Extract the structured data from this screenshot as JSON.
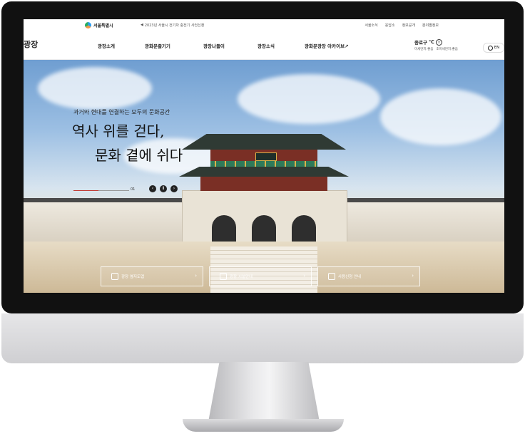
{
  "utility_bar": {
    "seoul_logo": "서울특별시",
    "notice": "2023년 서울시 전기차 충전기 사전신청",
    "links": [
      "서울소식",
      "응답소",
      "정보공개",
      "분야별정보"
    ]
  },
  "header": {
    "logo": "광장",
    "nav": [
      "광장소개",
      "광화문즐기기",
      "광장나들이",
      "광장소식",
      "광화문광장 아카이브"
    ],
    "weather": {
      "location": "종로구",
      "temp": "℃",
      "fine_dust": "미세먼지:좋음",
      "ultra_fine_dust": "초미세먼지:좋음"
    },
    "lang": "EN"
  },
  "hero": {
    "subtitle": "과거와 현대를 연결하는 모두의 문화공간",
    "title_line1": "역사 위를 걷다,",
    "title_line2": "문화 곁에 쉬다",
    "counter": "01",
    "progress": 0.45,
    "plaque": "光化門"
  },
  "quick_links": [
    "광장 옆지도맵",
    "광장 시설안내",
    "사용신청 안내"
  ],
  "colors": {
    "accent": "#c23a32",
    "text": "#222222"
  }
}
